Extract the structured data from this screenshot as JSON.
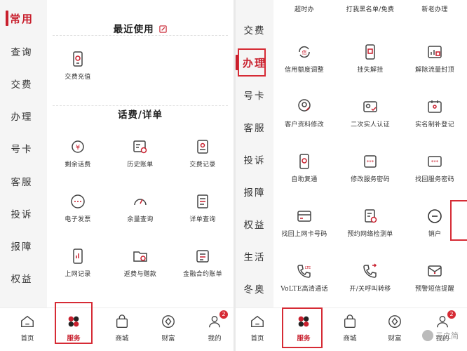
{
  "left": {
    "sidebar": {
      "items": [
        "常用",
        "查询",
        "交费",
        "办理",
        "号卡",
        "客服",
        "投诉",
        "报障",
        "权益"
      ]
    },
    "sections": [
      {
        "title": "最近使用",
        "items": [
          {
            "label": "交费充值",
            "icon": "phone-pay-icon"
          }
        ]
      },
      {
        "title": "话费/详单",
        "items": [
          {
            "label": "剩余话费",
            "icon": "yuan-coin-icon"
          },
          {
            "label": "历史账单",
            "icon": "bill-history-icon"
          },
          {
            "label": "交费记录",
            "icon": "payment-record-icon"
          },
          {
            "label": "电子发票",
            "icon": "e-invoice-icon"
          },
          {
            "label": "余量查询",
            "icon": "gauge-icon"
          },
          {
            "label": "详单查询",
            "icon": "detail-list-icon"
          },
          {
            "label": "上网记录",
            "icon": "data-record-icon"
          },
          {
            "label": "返费与赠款",
            "icon": "rebate-folder-icon"
          },
          {
            "label": "金融合约账单",
            "icon": "contract-bill-icon"
          }
        ]
      }
    ]
  },
  "right": {
    "sidebar": {
      "items": [
        "交费",
        "办理",
        "号卡",
        "客服",
        "投诉",
        "报障",
        "权益",
        "生活",
        "冬奥"
      ]
    },
    "top_cut_labels": [
      "超时办",
      "打我黑名单/免费",
      "新老办理"
    ],
    "items": [
      {
        "label": "信用额度调整",
        "icon": "credit-adjust-icon"
      },
      {
        "label": "挂失解挂",
        "icon": "report-loss-icon"
      },
      {
        "label": "解除流量封顶",
        "icon": "unlock-data-icon"
      },
      {
        "label": "客户资料修改",
        "icon": "edit-profile-icon"
      },
      {
        "label": "二次实人认证",
        "icon": "id-verify-icon"
      },
      {
        "label": "实名制补登记",
        "icon": "realname-register-icon"
      },
      {
        "label": "自助复通",
        "icon": "self-restore-icon"
      },
      {
        "label": "修改服务密码",
        "icon": "change-password-icon"
      },
      {
        "label": "找回服务密码",
        "icon": "recover-password-icon"
      },
      {
        "label": "找回上网卡号码",
        "icon": "recover-card-icon"
      },
      {
        "label": "预约网络检测单",
        "icon": "network-check-icon"
      },
      {
        "label": "销户",
        "icon": "cancel-account-icon"
      },
      {
        "label": "VoLTE高清通话",
        "icon": "volte-call-icon"
      },
      {
        "label": "开/关呼叫转移",
        "icon": "call-forward-icon"
      },
      {
        "label": "预警短信提醒",
        "icon": "sms-alert-icon"
      }
    ]
  },
  "tabs": [
    {
      "label": "首页",
      "icon": "home-icon"
    },
    {
      "label": "服务",
      "icon": "service-clover-icon"
    },
    {
      "label": "商城",
      "icon": "shopping-bag-icon"
    },
    {
      "label": "财富",
      "icon": "wealth-icon"
    },
    {
      "label": "我的",
      "icon": "user-icon",
      "badge": "2"
    }
  ],
  "watermark": "云之简",
  "colors": {
    "accent": "#c81f2d",
    "icon": "#444444",
    "background": "#f5f5f5"
  }
}
